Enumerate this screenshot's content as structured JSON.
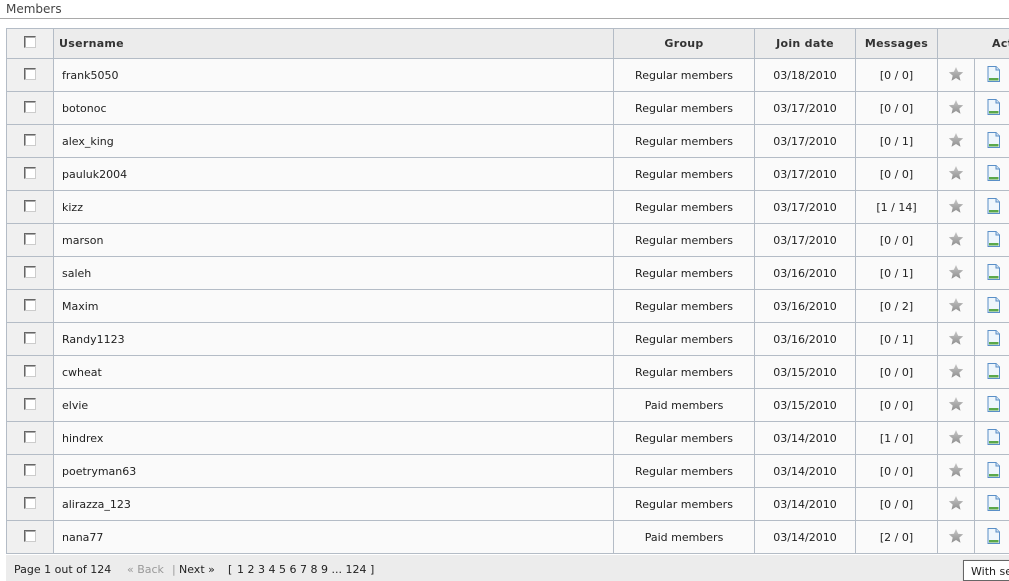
{
  "section": {
    "title": "Members"
  },
  "table": {
    "headers": {
      "username": "Username",
      "group": "Group",
      "join_date": "Join date",
      "messages": "Messages",
      "actions": "Actions"
    },
    "rows": [
      {
        "username": "frank5050",
        "group": "Regular members",
        "join_date": "03/18/2010",
        "messages": "[0 / 0]"
      },
      {
        "username": "botonoc",
        "group": "Regular members",
        "join_date": "03/17/2010",
        "messages": "[0 / 0]"
      },
      {
        "username": "alex_king",
        "group": "Regular members",
        "join_date": "03/17/2010",
        "messages": "[0 / 1]"
      },
      {
        "username": "pauluk2004",
        "group": "Regular members",
        "join_date": "03/17/2010",
        "messages": "[0 / 0]"
      },
      {
        "username": "kizz",
        "group": "Regular members",
        "join_date": "03/17/2010",
        "messages": "[1 / 14]"
      },
      {
        "username": "marson",
        "group": "Regular members",
        "join_date": "03/17/2010",
        "messages": "[0 / 0]"
      },
      {
        "username": "saleh",
        "group": "Regular members",
        "join_date": "03/16/2010",
        "messages": "[0 / 1]"
      },
      {
        "username": "Maxim",
        "group": "Regular members",
        "join_date": "03/16/2010",
        "messages": "[0 / 2]"
      },
      {
        "username": "Randy1123",
        "group": "Regular members",
        "join_date": "03/16/2010",
        "messages": "[0 / 1]"
      },
      {
        "username": "cwheat",
        "group": "Regular members",
        "join_date": "03/15/2010",
        "messages": "[0 / 0]"
      },
      {
        "username": "elvie",
        "group": "Paid members",
        "join_date": "03/15/2010",
        "messages": "[0 / 0]"
      },
      {
        "username": "hindrex",
        "group": "Regular members",
        "join_date": "03/14/2010",
        "messages": "[1 / 0]"
      },
      {
        "username": "poetryman63",
        "group": "Regular members",
        "join_date": "03/14/2010",
        "messages": "[0 / 0]"
      },
      {
        "username": "alirazza_123",
        "group": "Regular members",
        "join_date": "03/14/2010",
        "messages": "[0 / 0]"
      },
      {
        "username": "nana77",
        "group": "Paid members",
        "join_date": "03/14/2010",
        "messages": "[2 / 0]"
      }
    ],
    "row_icons": [
      "star-icon",
      "document-icon"
    ]
  },
  "pager": {
    "status": "Page 1 out of 124",
    "back": "« Back",
    "separator": "|",
    "next": "Next »",
    "open_bracket": "[",
    "pages": [
      "1",
      "2",
      "3",
      "4",
      "5",
      "6",
      "7",
      "8",
      "9"
    ],
    "ellipsis": "...",
    "last_page": "124",
    "close_bracket": "]"
  },
  "tooltip": {
    "text": "With selected"
  },
  "colors": {
    "header_bg": "#ececec",
    "border": "#b4bcc6",
    "row_bg": "#fafafa",
    "star": "#a8a8a8",
    "doc_blue": "#5a8fc7",
    "doc_green": "#5aa84a"
  }
}
